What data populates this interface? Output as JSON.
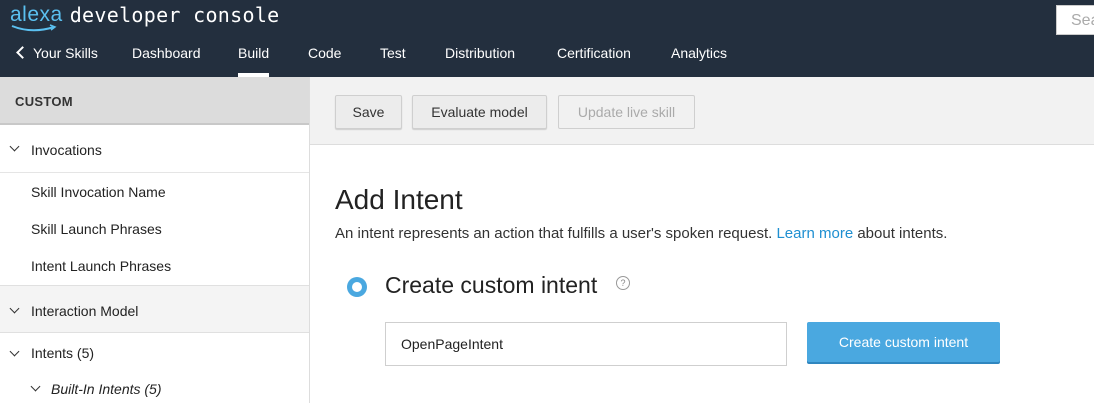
{
  "header": {
    "logo_brand": "alexa",
    "logo_product": "developer console",
    "search_placeholder": "Sea"
  },
  "nav": {
    "items": [
      {
        "label": "Your Skills",
        "active": false
      },
      {
        "label": "Dashboard",
        "active": false
      },
      {
        "label": "Build",
        "active": true
      },
      {
        "label": "Code",
        "active": false
      },
      {
        "label": "Test",
        "active": false
      },
      {
        "label": "Distribution",
        "active": false
      },
      {
        "label": "Certification",
        "active": false
      },
      {
        "label": "Analytics",
        "active": false
      }
    ]
  },
  "sidebar": {
    "section_title": "CUSTOM",
    "invocations": "Invocations",
    "invocation_items": [
      "Skill Invocation Name",
      "Skill Launch Phrases",
      "Intent Launch Phrases"
    ],
    "interaction_model": "Interaction Model",
    "intents": "Intents (5)",
    "builtin_intents": "Built-In Intents (5)"
  },
  "toolbar": {
    "save": "Save",
    "evaluate": "Evaluate model",
    "update": "Update live skill"
  },
  "content": {
    "title": "Add Intent",
    "description_pre": "An intent represents an action that fulfills a user's spoken request.",
    "learn_more": "Learn more",
    "description_post": "about intents.",
    "option_label": "Create custom intent",
    "help_icon": "?",
    "intent_value": "OpenPageIntent",
    "create_button": "Create custom intent"
  },
  "colors": {
    "header_bg": "#232f3e",
    "accent": "#4aa8e0",
    "link": "#1e8fd1"
  }
}
